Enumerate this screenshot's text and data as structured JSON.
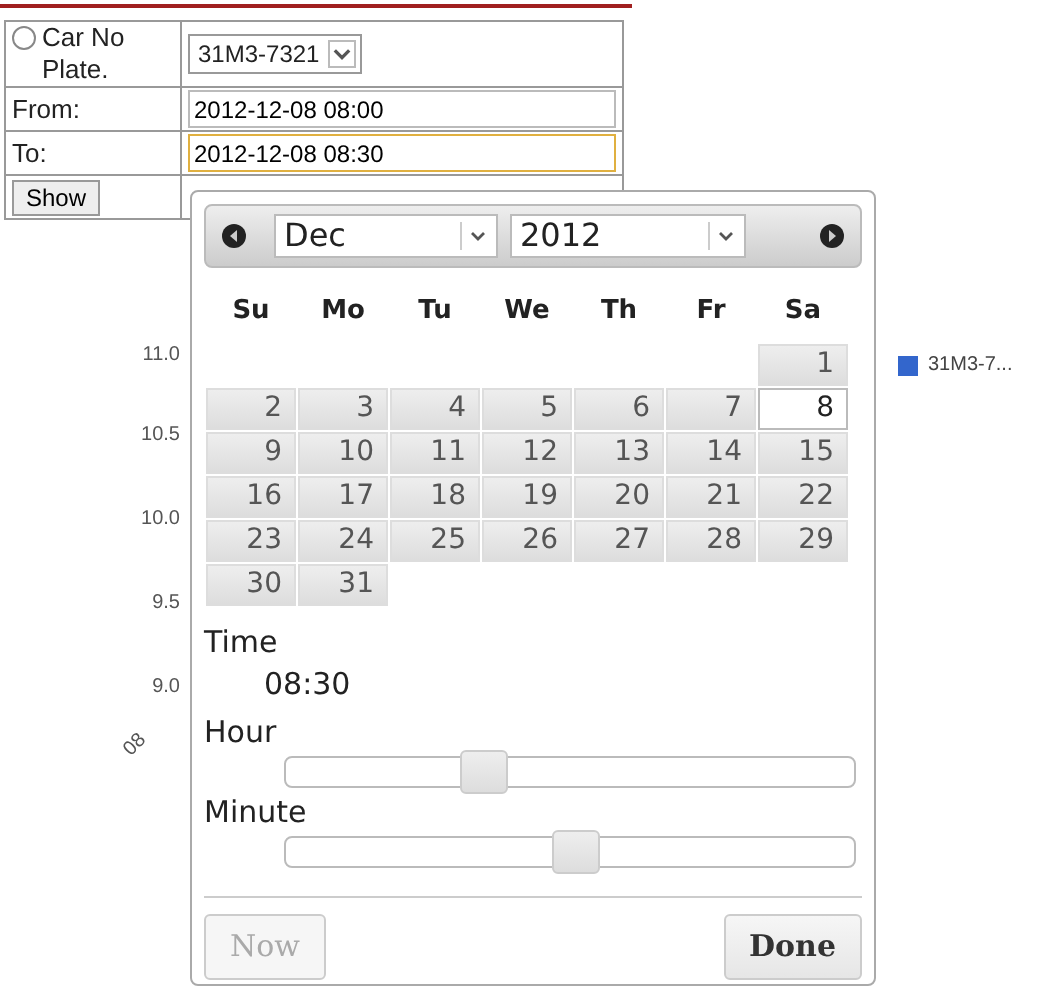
{
  "form": {
    "radio": {
      "label": "Car No Plate.",
      "checked": false
    },
    "plate_select": {
      "value": "31M3-7321"
    },
    "from": {
      "label": "From:",
      "value": "2012-12-08 08:00",
      "focused": false
    },
    "to": {
      "label": "To:",
      "value": "2012-12-08 08:30",
      "focused": true
    },
    "show_button": "Show"
  },
  "chart": {
    "yticks": [
      "11.0",
      "10.5",
      "10.0",
      "9.5",
      "9.0"
    ],
    "x_label": "08",
    "legend": [
      {
        "label": "31M3-7...",
        "color": "#3366cc"
      }
    ]
  },
  "datepicker": {
    "month": "Dec",
    "year": "2012",
    "weekdays": [
      "Su",
      "Mo",
      "Tu",
      "We",
      "Th",
      "Fr",
      "Sa"
    ],
    "weeks": [
      [
        {
          "day": "1",
          "selected": false
        }
      ],
      [
        {
          "day": "2",
          "selected": false
        },
        {
          "day": "3",
          "selected": false
        },
        {
          "day": "4",
          "selected": false
        },
        {
          "day": "5",
          "selected": false
        },
        {
          "day": "6",
          "selected": false
        },
        {
          "day": "7",
          "selected": false
        },
        {
          "day": "8",
          "selected": true
        }
      ],
      [
        {
          "day": "9",
          "selected": false
        },
        {
          "day": "10",
          "selected": false
        },
        {
          "day": "11",
          "selected": false
        },
        {
          "day": "12",
          "selected": false
        },
        {
          "day": "13",
          "selected": false
        },
        {
          "day": "14",
          "selected": false
        },
        {
          "day": "15",
          "selected": false
        }
      ],
      [
        {
          "day": "16",
          "selected": false
        },
        {
          "day": "17",
          "selected": false
        },
        {
          "day": "18",
          "selected": false
        },
        {
          "day": "19",
          "selected": false
        },
        {
          "day": "20",
          "selected": false
        },
        {
          "day": "21",
          "selected": false
        },
        {
          "day": "22",
          "selected": false
        }
      ],
      [
        {
          "day": "23",
          "selected": false
        },
        {
          "day": "24",
          "selected": false
        },
        {
          "day": "25",
          "selected": false
        },
        {
          "day": "26",
          "selected": false
        },
        {
          "day": "27",
          "selected": false
        },
        {
          "day": "28",
          "selected": false
        },
        {
          "day": "29",
          "selected": false
        }
      ],
      [
        {
          "day": "30",
          "selected": false
        },
        {
          "day": "31",
          "selected": false
        }
      ]
    ],
    "time_label": "Time",
    "time_value": "08:30",
    "sliders": [
      {
        "label": "Hour",
        "level": 0.35
      },
      {
        "label": "Minute",
        "level": 0.51
      }
    ],
    "buttons": [
      {
        "label": "Now",
        "disabled": true
      },
      {
        "label": "Done",
        "disabled": false
      }
    ]
  }
}
